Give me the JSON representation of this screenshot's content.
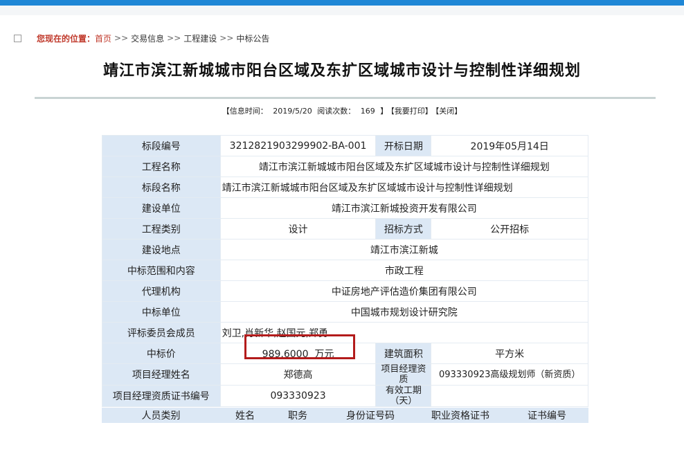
{
  "breadcrumb": {
    "label": "您现在的位置：",
    "home": "首页",
    "sep": ">>",
    "items": [
      "交易信息",
      "工程建设",
      "中标公告"
    ]
  },
  "page_title": "靖江市滨江新城城市阳台区域及东扩区域城市设计与控制性详细规划",
  "info_bar": {
    "time_label": "【信息时间：",
    "time_value": "2019/5/20",
    "read_label": "阅读次数：",
    "read_value": "169",
    "close_bracket": "】",
    "print": "【我要打印】",
    "close": "【关闭】"
  },
  "table": {
    "bid_section_no_label": "标段编号",
    "bid_section_no": "3212821903299902-BA-001",
    "open_date_label": "开标日期",
    "open_date": "2019年05月14日",
    "project_name_label": "工程名称",
    "project_name": "靖江市滨江新城城市阳台区域及东扩区域城市设计与控制性详细规划",
    "section_name_label": "标段名称",
    "section_name": "靖江市滨江新城城市阳台区域及东扩区域城市设计与控制性详细规划",
    "builder_label": "建设单位",
    "builder": "靖江市滨江新城投资开发有限公司",
    "project_type_label": "工程类别",
    "project_type": "设计",
    "tender_method_label": "招标方式",
    "tender_method": "公开招标",
    "location_label": "建设地点",
    "location": "靖江市滨江新城",
    "scope_label": "中标范围和内容",
    "scope": "市政工程",
    "agent_label": "代理机构",
    "agent": "中证房地产评估造价集团有限公司",
    "winner_label": "中标单位",
    "winner": "中国城市规划设计研究院",
    "committee_label": "评标委员会成员",
    "committee": "刘卫,肖新华,赵国元,郑勇",
    "price_label": "中标价",
    "price": "989.6000  万元",
    "area_label": "建筑面积",
    "area": "平方米",
    "manager_label": "项目经理姓名",
    "manager": "郑德高",
    "manager_qual_label": "项目经理资质",
    "manager_qual": "093330923高级规划师（新资质）",
    "cert_label": "项目经理资质证书编号",
    "cert": "093330923",
    "period_label": "有效工期（天）",
    "period": ""
  },
  "staff_header": [
    "人员类别",
    "姓名",
    "职务",
    "身份证号码",
    "职业资格证书",
    "证书编号"
  ]
}
